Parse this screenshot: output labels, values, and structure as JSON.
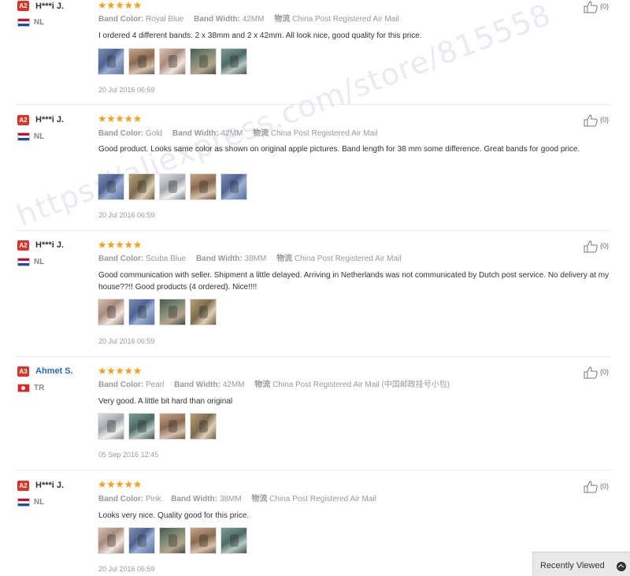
{
  "watermark": "https://aliexpress.com/store/815558",
  "recently_viewed": "Recently Viewed",
  "labels": {
    "color": "Band Color:",
    "width": "Band Width:",
    "ship": "物流"
  },
  "colors": {
    "badge": "#d8362a",
    "star": "#f4a021",
    "link": "#2a67b7"
  },
  "reviews": [
    {
      "level": "A2",
      "user": "H***i J.",
      "country": "NL",
      "stars": "★★★★★",
      "band_color": "Royal Blue",
      "band_width": "42MM",
      "shipping": "China Post Registered Air Mail",
      "text": "I ordered 4 different bands. 2 x 38mm and 2 x 42mm. All look nice, good quality for this price.",
      "date": "20 Jul 2016 06:59",
      "helpful": "(0)"
    },
    {
      "level": "A2",
      "user": "H***i J.",
      "country": "NL",
      "stars": "★★★★★",
      "band_color": "Gold",
      "band_width": "42MM",
      "shipping": "China Post Registered Air Mail",
      "text": "Good product. Looks same color as shown on original apple pictures. Band length for 38 mm some difference. Great bands for good price.",
      "date": "20 Jul 2016 06:59",
      "helpful": "(0)"
    },
    {
      "level": "A2",
      "user": "H***i J.",
      "country": "NL",
      "stars": "★★★★★",
      "band_color": "Scuba Blue",
      "band_width": "38MM",
      "shipping": "China Post Registered Air Mail",
      "text": "Good communication with seller. Shipment a little delayed. Arriving in Netherlands was not communicated by Dutch post service. No delivery at my house??!! Good products (4 ordered). Nice!!!!",
      "date": "20 Jul 2016 06:59",
      "helpful": "(0)"
    },
    {
      "level": "A3",
      "user": "Ahmet S.",
      "country": "TR",
      "stars": "★★★★★",
      "band_color": "Pearl",
      "band_width": "42MM",
      "shipping": "China Post Registered Air Mail (中国邮政挂号小包)",
      "text": "Very good. A little bit hard than original",
      "date": "05 Sep 2016 12:45",
      "helpful": "(0)"
    },
    {
      "level": "A2",
      "user": "H***i J.",
      "country": "NL",
      "stars": "★★★★★",
      "band_color": "Pink",
      "band_width": "38MM",
      "shipping": "China Post Registered Air Mail",
      "text": "Looks very nice. Quality good for this price.",
      "date": "20 Jul 2016 06:59",
      "helpful": "(0)"
    }
  ]
}
